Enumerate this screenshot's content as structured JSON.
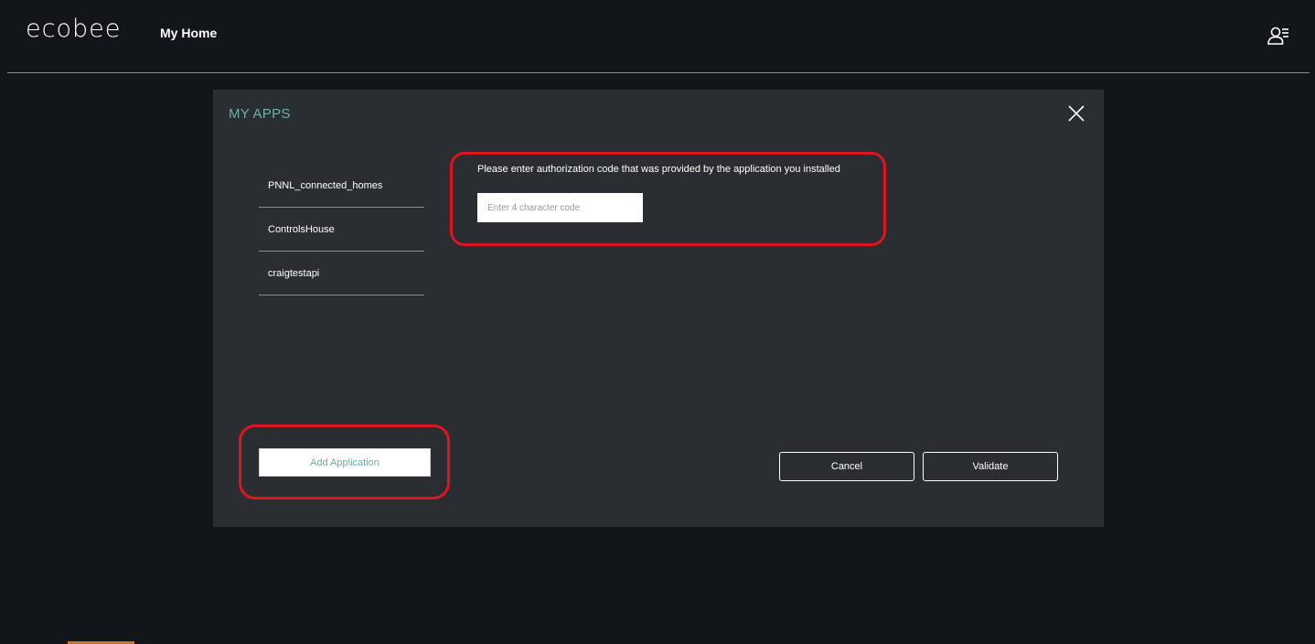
{
  "header": {
    "logo": "ecobee",
    "nav_home": "My Home",
    "user_icon": "user-menu-icon"
  },
  "modal": {
    "title": "MY APPS",
    "close_icon": "close-icon",
    "apps": [
      {
        "label": "PNNL_connected_homes"
      },
      {
        "label": "ControlsHouse"
      },
      {
        "label": "craigtestapi"
      }
    ],
    "auth_prompt": "Please enter authorization code that was provided by the application you installed",
    "code_input": {
      "value": "",
      "placeholder": "Enter 4 character code"
    },
    "add_button": "Add Application",
    "cancel_button": "Cancel",
    "validate_button": "Validate"
  },
  "colors": {
    "background": "#121519",
    "modal_bg": "#2a2e33",
    "accent_teal": "#66b2ac",
    "highlight_red": "#e0141e",
    "footer_orange": "#c9712a"
  }
}
